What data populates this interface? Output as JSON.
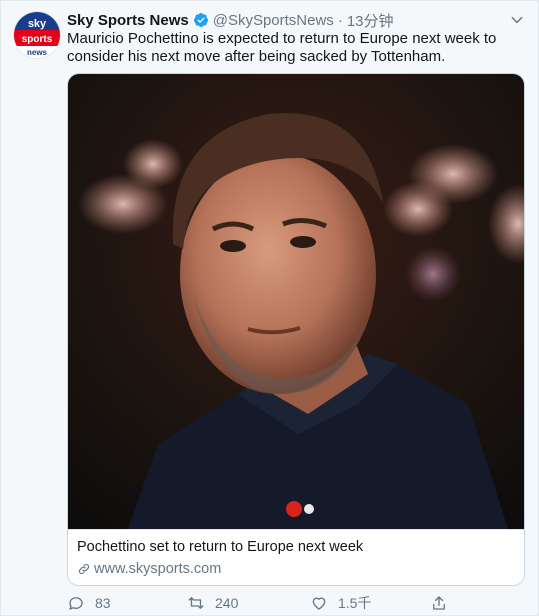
{
  "tweet": {
    "author_name": "Sky Sports News",
    "handle": "@SkySportsNews",
    "separator": "·",
    "time": "13分钟",
    "text": "Mauricio Pochettino is expected to return to Europe next week to consider his next move after being sacked by Tottenham.",
    "verified": true
  },
  "avatar": {
    "logo_lines": [
      "sky",
      "sports",
      "news"
    ],
    "colors": {
      "top": "#1a3c8c",
      "middle": "#e2001a",
      "bottom": "#ffffff"
    }
  },
  "card": {
    "title": "Pochettino set to return to Europe next week",
    "link": "www.skysports.com"
  },
  "actions": {
    "replies": "83",
    "retweets": "240",
    "likes": "1.5千",
    "share_icon": "share-icon"
  },
  "colors": {
    "background": "#f5f8fa",
    "verified": "#1da1f2",
    "muted_text": "#657786"
  }
}
